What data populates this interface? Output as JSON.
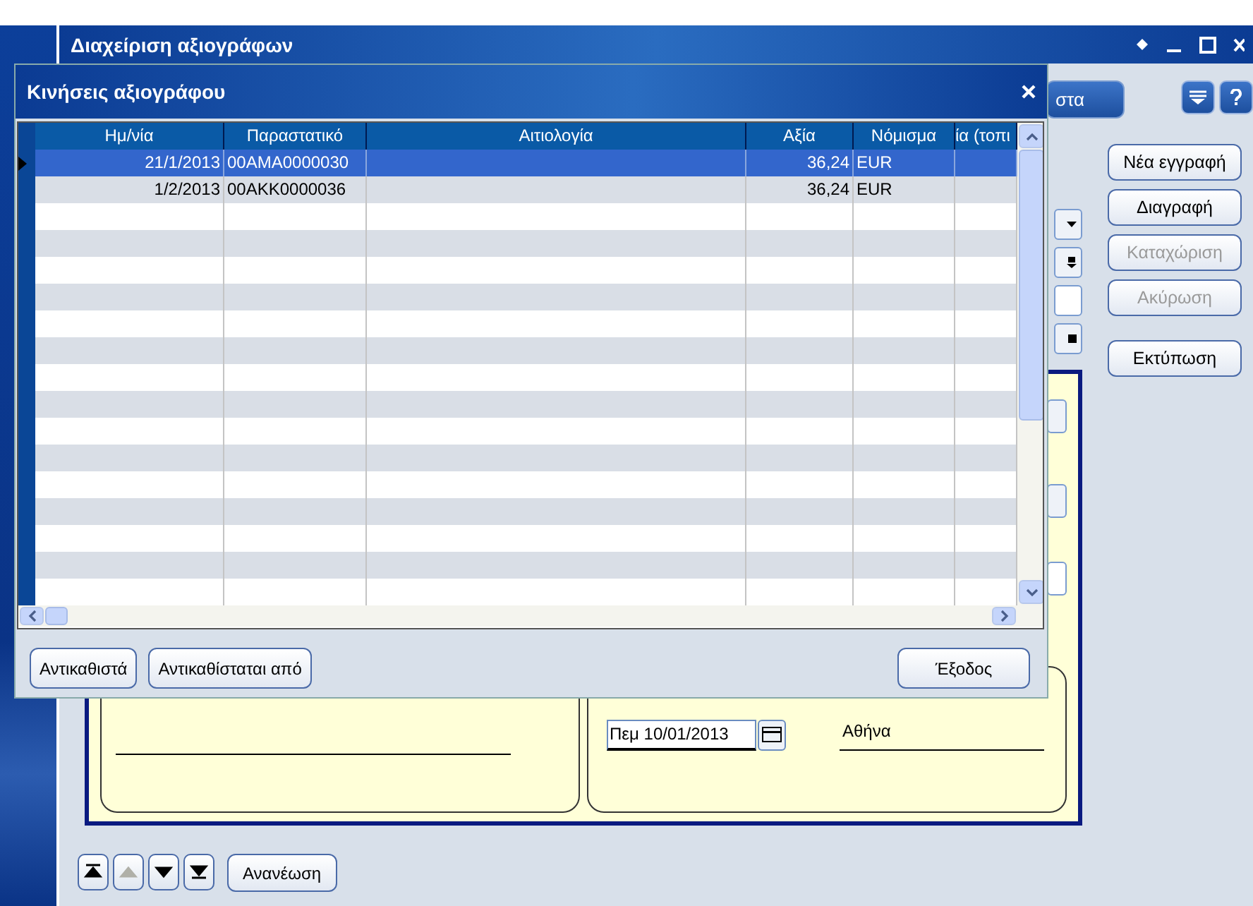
{
  "main_window": {
    "title": "Διαχείριση αξιογράφων",
    "toolbar_button": "στα",
    "actions": [
      {
        "label": "Νέα εγγραφή",
        "disabled": false
      },
      {
        "label": "Διαγραφή",
        "disabled": false
      },
      {
        "label": "Καταχώριση",
        "disabled": true
      },
      {
        "label": "Ακύρωση",
        "disabled": true
      },
      {
        "label": "Εκτύπωση",
        "disabled": false
      }
    ],
    "date_field": {
      "value": "Πεμ 10/01/2013"
    },
    "city": "Αθήνα",
    "nav": [
      {
        "kind": "first",
        "disabled": false
      },
      {
        "kind": "up",
        "disabled": true
      },
      {
        "kind": "down",
        "disabled": false
      },
      {
        "kind": "last",
        "disabled": false
      }
    ],
    "refresh_button": "Ανανέωση"
  },
  "dialog": {
    "title": "Κινήσεις αξιογράφου",
    "columns": [
      "Ημ/νία",
      "Παραστατικό",
      "Αιτιολογία",
      "Αξία",
      "Νόμισμα",
      "ία (τοπι"
    ],
    "rows": [
      {
        "cells": [
          "21/1/2013",
          "00AMA0000030",
          "",
          "36,24",
          "EUR",
          ""
        ],
        "selected": true
      },
      {
        "cells": [
          "1/2/2013",
          "00AKK0000036",
          "",
          "36,24",
          "EUR",
          ""
        ],
        "selected": false
      }
    ],
    "buttons": [
      {
        "label": "Αντικαθιστά",
        "kind": "left"
      },
      {
        "label": "Αντικαθίσταται από",
        "kind": "left"
      },
      {
        "label": "Έξοδος",
        "kind": "right"
      }
    ]
  }
}
